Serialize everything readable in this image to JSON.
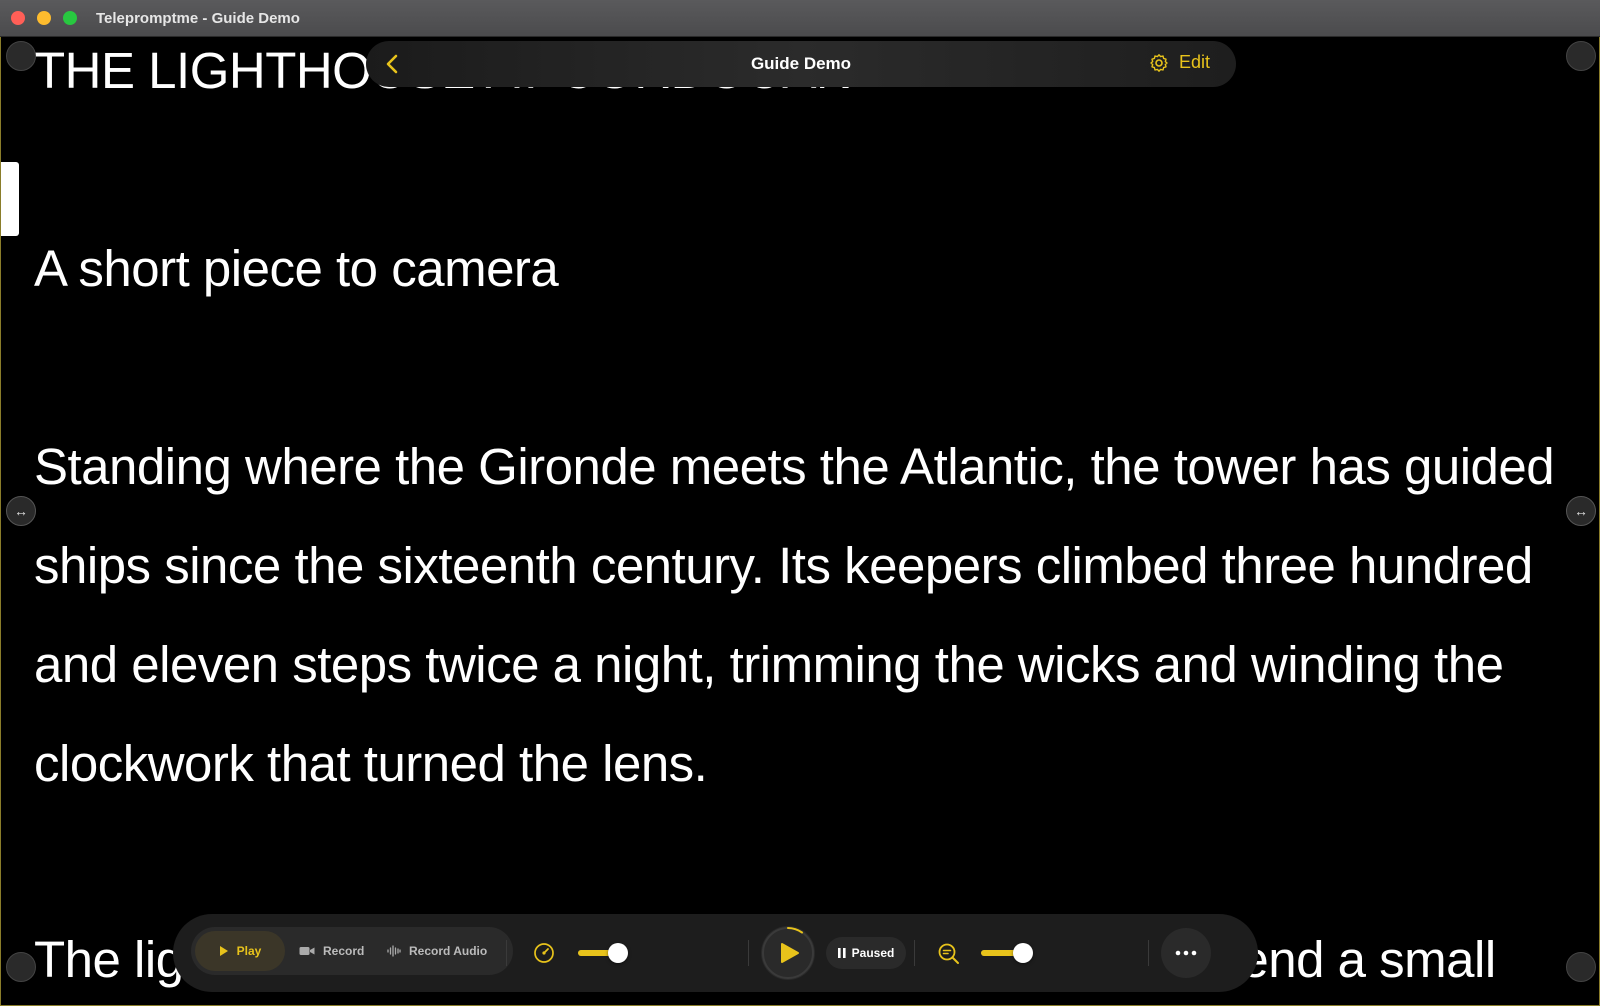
{
  "window": {
    "title": "Telepromptme - Guide Demo"
  },
  "topbar": {
    "title": "Guide Demo",
    "edit_label": "Edit",
    "back_icon": "chevron-left-icon",
    "settings_icon": "gear-icon"
  },
  "script": {
    "heading": "THE LIGHTHOUSE AT CORDOUAN",
    "subtitle": "A short piece to camera",
    "paragraph_lines": [
      "Standing where the Gironde meets the Atlantic, the tower has guided",
      "ships since the sixteenth century. Its keepers climbed three hundred",
      "and eleven steps twice a night, trimming the wicks and winding the",
      "clockwork that turned the lens."
    ],
    "next_line": "The light itself is the marvel: concentric rings of glass bend a small"
  },
  "controls": {
    "mode_buttons": [
      {
        "label": "Play",
        "icon": "play-icon"
      },
      {
        "label": "Record",
        "icon": "video-camera-icon"
      },
      {
        "label": "Record Audio",
        "icon": "waveform-icon"
      }
    ],
    "active_mode": "Play",
    "speed_icon": "speedometer-icon",
    "speed_level": 0.75,
    "playback_icon": "play-icon",
    "status_label": "Paused",
    "status_icon": "pause-icon",
    "zoom_icon": "zoom-out-icon",
    "zoom_level": 0.8,
    "more_icon": "ellipsis-icon"
  },
  "colors": {
    "accent": "#e8c31b",
    "background": "#000000",
    "text": "#ffffff"
  }
}
